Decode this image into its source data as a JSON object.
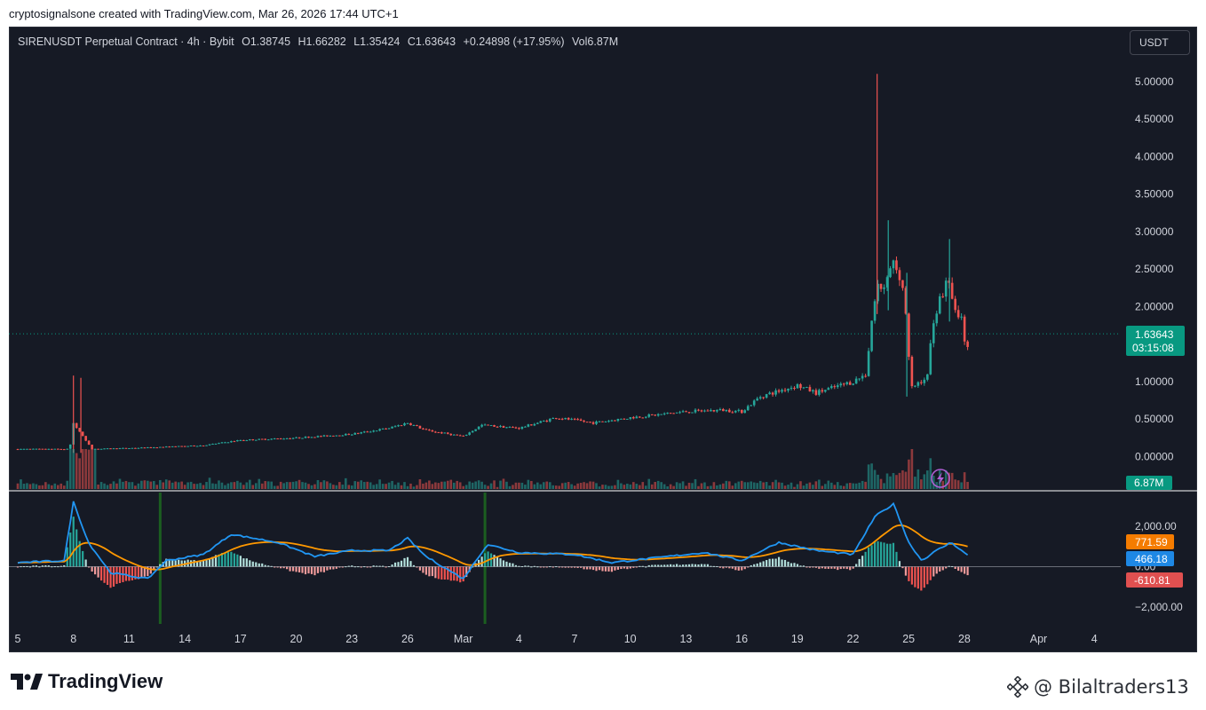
{
  "credit": "cryptosignalsone created with TradingView.com, Mar 26, 2026 17:44 UTC+1",
  "legend": {
    "symbol": "SIRENUSDT Perpetual Contract · 4h · Bybit",
    "open": "O1.38745",
    "high": "H1.66282",
    "low": "L1.35424",
    "close": "C1.63643",
    "change": "+0.24898 (+17.95%)",
    "volume": "Vol6.87M"
  },
  "currency_button": "USDT",
  "brand": "TradingView",
  "watermark": "@ Bilaltraders13",
  "colors": {
    "background": "#161a25",
    "up": "#26a69a",
    "down": "#ef5350",
    "macd": "#2196f3",
    "signal": "#ff9800",
    "accent": "#089981"
  },
  "chart_data": {
    "type": "candlestick",
    "timeframe": "4h",
    "y_axis": {
      "ticks": [
        {
          "value": 5.0,
          "label": "5.00000"
        },
        {
          "value": 4.5,
          "label": "4.50000"
        },
        {
          "value": 4.0,
          "label": "4.00000"
        },
        {
          "value": 3.5,
          "label": "3.50000"
        },
        {
          "value": 3.0,
          "label": "3.00000"
        },
        {
          "value": 2.5,
          "label": "2.50000"
        },
        {
          "value": 2.0,
          "label": "2.00000"
        },
        {
          "value": 1.0,
          "label": "1.00000"
        },
        {
          "value": 0.5,
          "label": "0.50000"
        },
        {
          "value": 0.0,
          "label": "0.00000"
        }
      ]
    },
    "x_axis": {
      "ticks": [
        {
          "day": 5,
          "label": "5"
        },
        {
          "day": 8,
          "label": "8"
        },
        {
          "day": 11,
          "label": "11"
        },
        {
          "day": 14,
          "label": "14"
        },
        {
          "day": 17,
          "label": "17"
        },
        {
          "day": 20,
          "label": "20"
        },
        {
          "day": 23,
          "label": "23"
        },
        {
          "day": 26,
          "label": "26"
        },
        {
          "day": 29,
          "label": "Mar"
        },
        {
          "day": 32,
          "label": "4"
        },
        {
          "day": 35,
          "label": "7"
        },
        {
          "day": 38,
          "label": "10"
        },
        {
          "day": 41,
          "label": "13"
        },
        {
          "day": 44,
          "label": "16"
        },
        {
          "day": 47,
          "label": "19"
        },
        {
          "day": 50,
          "label": "22"
        },
        {
          "day": 53,
          "label": "25"
        },
        {
          "day": 56,
          "label": "28"
        },
        {
          "day": 60,
          "label": "Apr"
        },
        {
          "day": 63,
          "label": "4"
        }
      ]
    },
    "last_price": {
      "value": 1.63643,
      "label": "1.63643",
      "countdown": "03:15:08"
    },
    "last_volume": {
      "label": "6.87M"
    },
    "price_path": [
      {
        "day": 5,
        "close": 0.1
      },
      {
        "day": 7.8,
        "close": 0.1
      },
      {
        "day": 8,
        "close": 0.45
      },
      {
        "day": 8.4,
        "close": 0.3
      },
      {
        "day": 9,
        "close": 0.1
      },
      {
        "day": 12,
        "close": 0.12
      },
      {
        "day": 15,
        "close": 0.15
      },
      {
        "day": 17,
        "close": 0.22
      },
      {
        "day": 20,
        "close": 0.25
      },
      {
        "day": 23,
        "close": 0.3
      },
      {
        "day": 25,
        "close": 0.38
      },
      {
        "day": 26,
        "close": 0.45
      },
      {
        "day": 27,
        "close": 0.35
      },
      {
        "day": 29,
        "close": 0.27
      },
      {
        "day": 30,
        "close": 0.42
      },
      {
        "day": 32,
        "close": 0.38
      },
      {
        "day": 34,
        "close": 0.52
      },
      {
        "day": 36,
        "close": 0.45
      },
      {
        "day": 38,
        "close": 0.52
      },
      {
        "day": 41,
        "close": 0.6
      },
      {
        "day": 43,
        "close": 0.62
      },
      {
        "day": 44,
        "close": 0.6
      },
      {
        "day": 45,
        "close": 0.8
      },
      {
        "day": 47,
        "close": 0.95
      },
      {
        "day": 48,
        "close": 0.85
      },
      {
        "day": 50,
        "close": 1.0
      },
      {
        "day": 50.7,
        "close": 1.1
      },
      {
        "day": 51,
        "close": 1.8
      },
      {
        "day": 51.4,
        "close": 2.3
      },
      {
        "day": 51.7,
        "close": 2.2
      },
      {
        "day": 52.1,
        "close": 2.6
      },
      {
        "day": 52.6,
        "close": 2.4
      },
      {
        "day": 52.9,
        "close": 1.8
      },
      {
        "day": 53.1,
        "close": 0.9
      },
      {
        "day": 53.6,
        "close": 1.0
      },
      {
        "day": 54.0,
        "close": 1.05
      },
      {
        "day": 54.3,
        "close": 1.8
      },
      {
        "day": 54.7,
        "close": 2.1
      },
      {
        "day": 55.1,
        "close": 2.4
      },
      {
        "day": 55.5,
        "close": 2.0
      },
      {
        "day": 55.9,
        "close": 1.8
      },
      {
        "day": 56.1,
        "close": 1.39
      },
      {
        "day": 56.3,
        "close": 1.636
      }
    ],
    "spikes": [
      {
        "day": 8.0,
        "high": 1.08,
        "low": 0.05
      },
      {
        "day": 8.4,
        "high": 1.05,
        "low": 0.05
      },
      {
        "day": 51.3,
        "high": 5.1,
        "low": 1.9
      },
      {
        "day": 51.9,
        "high": 3.15,
        "low": 1.95
      },
      {
        "day": 52.9,
        "high": 2.45,
        "low": 0.8
      },
      {
        "day": 55.2,
        "high": 2.9,
        "low": 1.8
      }
    ],
    "macd": {
      "levels": [
        {
          "value": 2000,
          "label": "2,000.00"
        },
        {
          "value": 0,
          "label": "0.00"
        },
        {
          "value": -2000,
          "label": "−2,000.00"
        }
      ],
      "signal_label": "771.59",
      "macd_label": "466.18",
      "histogram_label": "-610.81",
      "path": [
        {
          "day": 5,
          "macd": 200
        },
        {
          "day": 7.5,
          "macd": 300
        },
        {
          "day": 8.0,
          "macd": 3200
        },
        {
          "day": 8.8,
          "macd": 1200
        },
        {
          "day": 10,
          "macd": -300
        },
        {
          "day": 12,
          "macd": -600
        },
        {
          "day": 13,
          "macd": 300
        },
        {
          "day": 15,
          "macd": 600
        },
        {
          "day": 16.5,
          "macd": 1600
        },
        {
          "day": 19,
          "macd": 1200
        },
        {
          "day": 21,
          "macd": 500
        },
        {
          "day": 23,
          "macd": 800
        },
        {
          "day": 25,
          "macd": 800
        },
        {
          "day": 26,
          "macd": 1400
        },
        {
          "day": 27,
          "macd": 500
        },
        {
          "day": 29,
          "macd": -600
        },
        {
          "day": 30.3,
          "macd": 1100
        },
        {
          "day": 32,
          "macd": 700
        },
        {
          "day": 35,
          "macd": 600
        },
        {
          "day": 37,
          "macd": 200
        },
        {
          "day": 39,
          "macd": 400
        },
        {
          "day": 42,
          "macd": 700
        },
        {
          "day": 44,
          "macd": 300
        },
        {
          "day": 46,
          "macd": 1200
        },
        {
          "day": 48,
          "macd": 800
        },
        {
          "day": 50,
          "macd": 600
        },
        {
          "day": 51.2,
          "macd": 2500
        },
        {
          "day": 52.2,
          "macd": 3100
        },
        {
          "day": 53.0,
          "macd": 1200
        },
        {
          "day": 53.7,
          "macd": 300
        },
        {
          "day": 54.5,
          "macd": 800
        },
        {
          "day": 55.3,
          "macd": 1200
        },
        {
          "day": 56.3,
          "macd": 466
        }
      ]
    }
  }
}
